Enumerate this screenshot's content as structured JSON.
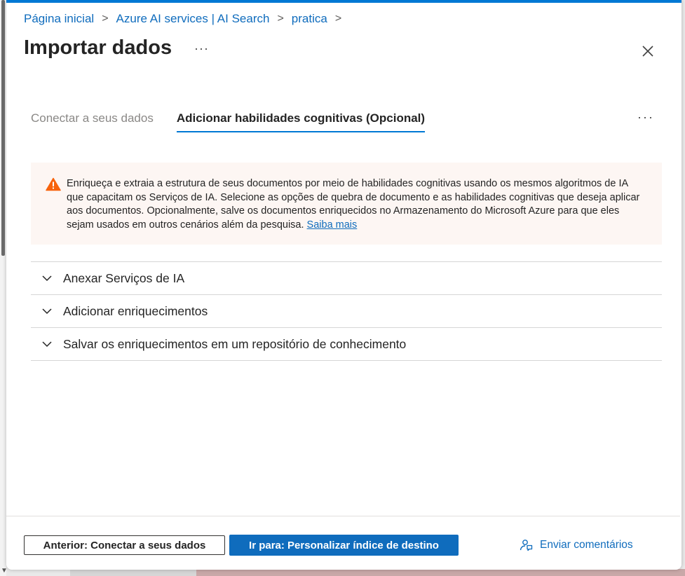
{
  "breadcrumb": [
    {
      "label": "Página inicial"
    },
    {
      "label": "Azure AI services | AI Search"
    },
    {
      "label": "pratica"
    }
  ],
  "breadcrumb_separator": ">",
  "header": {
    "title": "Importar dados",
    "more_label": "···",
    "close_icon": "close-icon"
  },
  "tabs": {
    "items": [
      {
        "label": "Conectar a seus dados",
        "active": false
      },
      {
        "label": "Adicionar habilidades cognitivas (Opcional)",
        "active": true
      }
    ],
    "more_label": "···"
  },
  "warning": {
    "icon": "warning-icon",
    "color": "#f7630c",
    "text": "Enriqueça e extraia a estrutura de seus documentos por meio de habilidades cognitivas usando os mesmos algoritmos de IA que capacitam os Serviços de IA. Selecione as opções de quebra de documento e as habilidades cognitivas que deseja aplicar aos documentos. Opcionalmente, salve os documentos enriquecidos no Armazenamento do Microsoft Azure para que eles sejam usados em outros cenários além da pesquisa.",
    "link_label": "Saiba mais"
  },
  "accordion": [
    {
      "label": "Anexar Serviços de IA",
      "icon": "chevron-down-icon"
    },
    {
      "label": "Adicionar enriquecimentos",
      "icon": "chevron-down-icon"
    },
    {
      "label": "Salvar os enriquecimentos em um repositório de conhecimento",
      "icon": "chevron-down-icon"
    }
  ],
  "footer": {
    "previous_label": "Anterior: Conectar a seus dados",
    "next_label": "Ir para: Personalizar índice de destino",
    "feedback_label": "Enviar comentários",
    "feedback_icon": "feedback-icon"
  },
  "colors": {
    "accent": "#0078d4",
    "link": "#0f6cbd",
    "warning_background": "#fdf6f3"
  }
}
